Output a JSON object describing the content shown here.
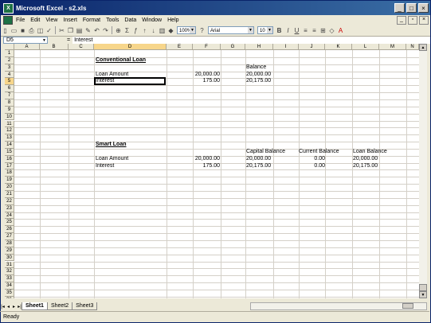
{
  "window": {
    "title": "Microsoft Excel - s2.xls",
    "app_icon": "X"
  },
  "menu": [
    "File",
    "Edit",
    "View",
    "Insert",
    "Format",
    "Tools",
    "Data",
    "Window",
    "Help"
  ],
  "toolbar": {
    "zoom": "100%",
    "font": "Arial",
    "size": "10"
  },
  "formula_bar": {
    "name_box": "D5",
    "eq": "=",
    "content": "Interest"
  },
  "columns": [
    "A",
    "B",
    "C",
    "D",
    "E",
    "F",
    "G",
    "H",
    "I",
    "J",
    "K",
    "L",
    "M",
    "N"
  ],
  "selected_column": "D",
  "selected_row": "5",
  "rows": [
    "1",
    "2",
    "3",
    "4",
    "5",
    "6",
    "7",
    "8",
    "9",
    "10",
    "11",
    "12",
    "13",
    "14",
    "15",
    "16",
    "17",
    "18",
    "19",
    "20",
    "21",
    "22",
    "23",
    "24",
    "25",
    "26",
    "27",
    "28",
    "29",
    "30",
    "31",
    "32",
    "33",
    "34",
    "35",
    "36"
  ],
  "cells": {
    "d2": "Conventional Loan",
    "h3": "Balance",
    "d4": "Loan Amount",
    "f4": "20,000.00",
    "h4": "20,000.00",
    "d5": "Interest",
    "f5": "175.00",
    "h5": "20,175.00",
    "d14": "Smart Loan",
    "h15": "Capital Balance",
    "j15": "Current Balance",
    "l15": "Loan Balance",
    "d16": "Loan Amount",
    "f16": "20,000.00",
    "h16": "20,000.00",
    "j16": "0.00",
    "l16": "20,000.00",
    "d17": "Interest",
    "f17": "175.00",
    "h17": "20,175.00",
    "j17": "0.00",
    "l17": "20,175.00"
  },
  "sheets": [
    "Sheet1",
    "Sheet2",
    "Sheet3"
  ],
  "status": "Ready"
}
